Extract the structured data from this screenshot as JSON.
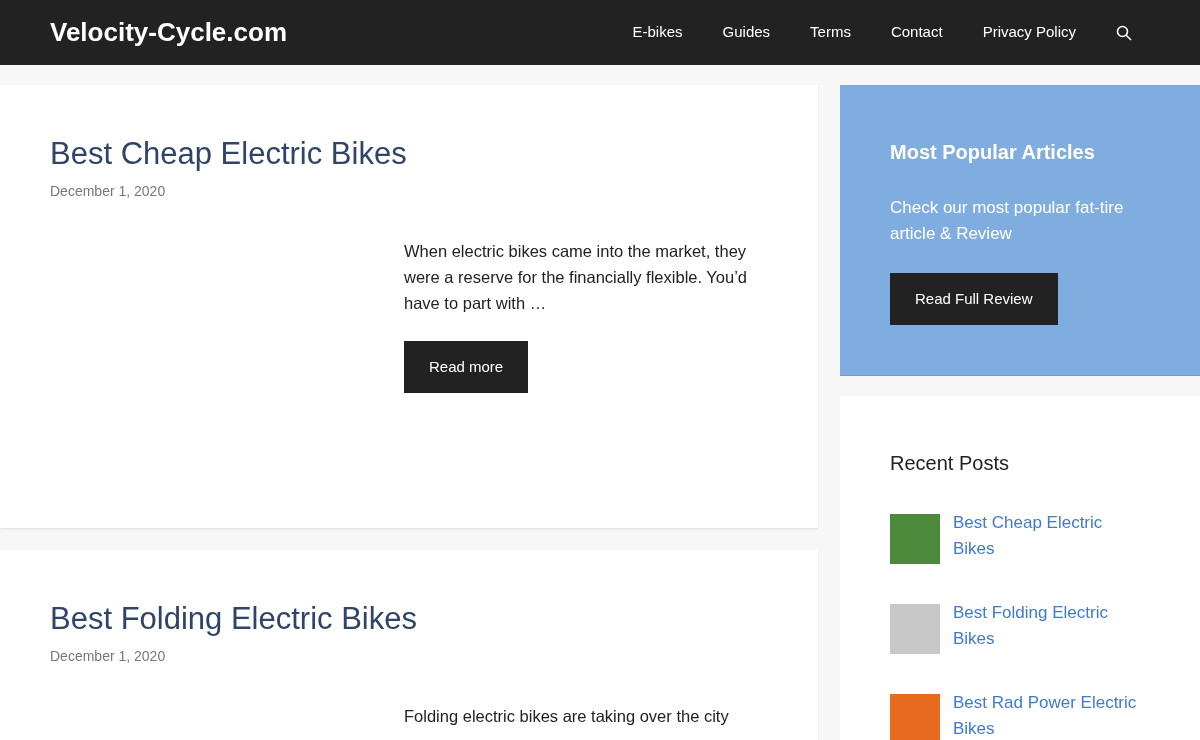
{
  "header": {
    "site_title": "Velocity-Cycle.com",
    "nav": [
      {
        "label": "E-bikes"
      },
      {
        "label": "Guides"
      },
      {
        "label": "Terms"
      },
      {
        "label": "Contact"
      },
      {
        "label": "Privacy Policy"
      }
    ]
  },
  "posts": [
    {
      "title": "Best Cheap Electric Bikes",
      "date": "December 1, 2020",
      "excerpt": "When electric bikes came into the market, they were a reserve for the financially flexible. You’d have to part with …",
      "button": "Read more"
    },
    {
      "title": "Best Folding Electric Bikes",
      "date": "December 1, 2020",
      "excerpt": "Folding electric bikes are taking over the city"
    }
  ],
  "sidebar": {
    "promo": {
      "title": "Most Popular Articles",
      "text": "Check our most popular fat-tire article & Review",
      "button": "Read Full Review"
    },
    "recent_posts": {
      "title": "Recent Posts",
      "items": [
        {
          "title": "Best Cheap Electric Bikes"
        },
        {
          "title": "Best Folding Electric Bikes"
        },
        {
          "title": "Best Rad Power Electric Bikes"
        }
      ]
    }
  }
}
